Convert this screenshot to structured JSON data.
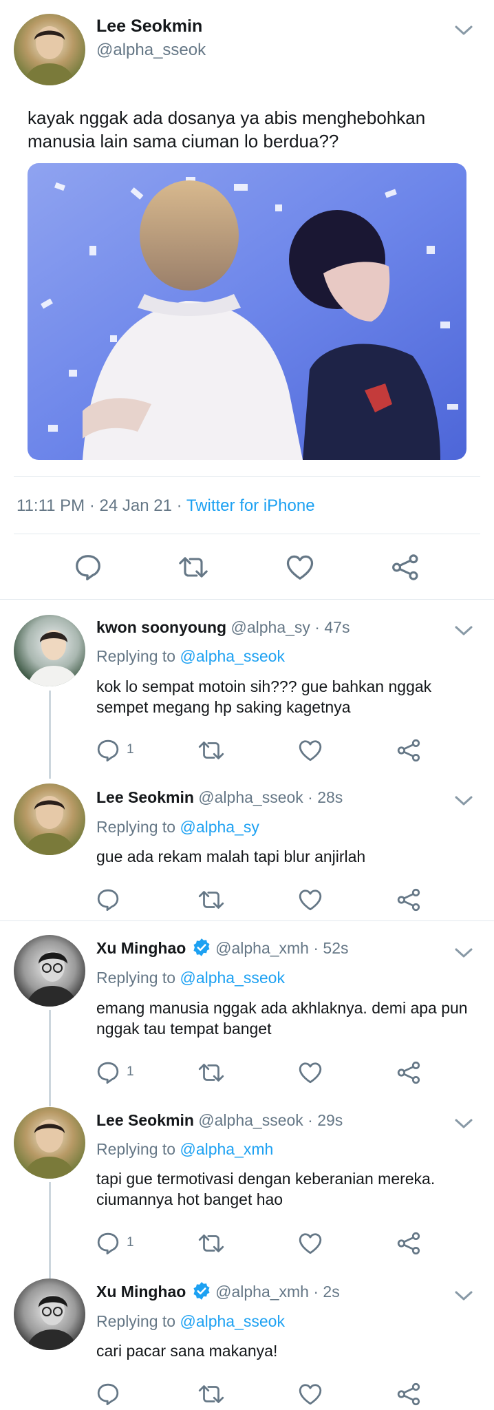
{
  "main_tweet": {
    "name": "Lee Seokmin",
    "handle": "@alpha_sseok",
    "text": "kayak nggak ada dosanya ya abis menghebohkan manusia lain sama ciuman lo berdua??",
    "time": "11:11 PM · 24 Jan 21 · ",
    "source": "Twitter for iPhone"
  },
  "replies": [
    {
      "name": "kwon soonyoung",
      "meta": "@alpha_sy · 47s",
      "replying_prefix": "Replying to ",
      "replying_to": "@alpha_sseok",
      "text": "kok lo sempat motoin sih??? gue bahkan nggak sempet megang hp saking kagetnya",
      "reply_count": "1"
    },
    {
      "name": "Lee Seokmin",
      "meta": "@alpha_sseok · 28s",
      "replying_prefix": "Replying to ",
      "replying_to": "@alpha_sy",
      "text": "gue ada rekam malah tapi blur anjirlah",
      "reply_count": ""
    },
    {
      "name": "Xu Minghao",
      "meta": "@alpha_xmh · 52s",
      "replying_prefix": "Replying to ",
      "replying_to": "@alpha_sseok",
      "text": "emang manusia nggak ada akhlaknya. demi apa pun nggak tau tempat banget",
      "reply_count": "1",
      "verified": true
    },
    {
      "name": "Lee Seokmin",
      "meta": "@alpha_sseok · 29s",
      "replying_prefix": "Replying to ",
      "replying_to": "@alpha_xmh",
      "text": "tapi gue termotivasi dengan keberanian mereka. ciumannya hot banget hao",
      "reply_count": "1"
    },
    {
      "name": "Xu Minghao",
      "meta": "@alpha_xmh · 2s",
      "replying_prefix": "Replying to ",
      "replying_to": "@alpha_sseok",
      "text": "cari pacar sana makanya!",
      "reply_count": "",
      "verified": true
    }
  ],
  "icons": {
    "reply": "reply-icon",
    "retweet": "retweet-icon",
    "like": "heart-icon",
    "share": "share-icon",
    "more": "chevron-down-icon",
    "verified": "verified-badge-icon"
  },
  "colors": {
    "accent": "#1da1f2",
    "muted": "#657786",
    "text": "#14171a"
  }
}
